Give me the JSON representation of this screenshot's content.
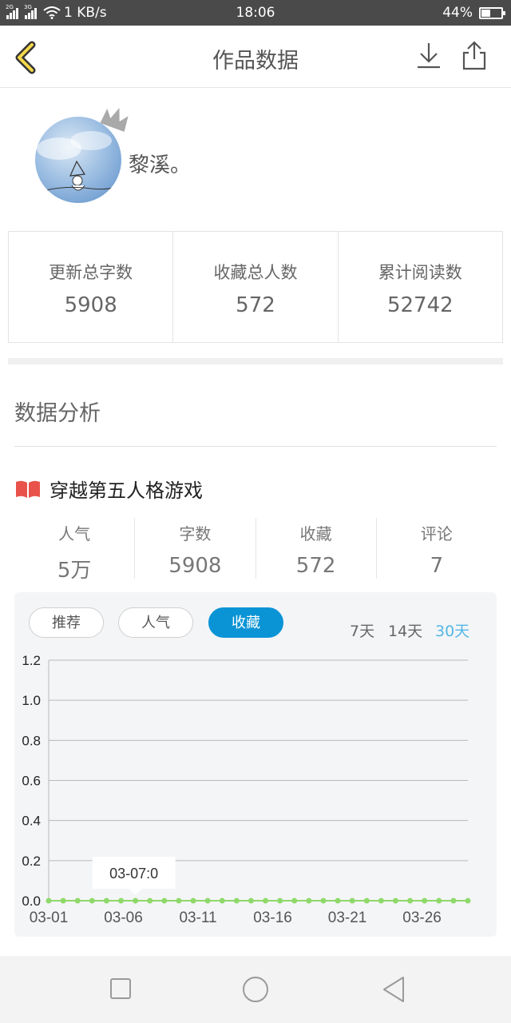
{
  "status_bar": {
    "signal_1_label": "2G",
    "signal_2_label": "3G",
    "network_speed": "1 KB/s",
    "time": "18:06",
    "battery_percent": "44%",
    "battery_level": 0.44
  },
  "header": {
    "title": "作品数据",
    "back_icon": "chevron-left-icon",
    "download_icon": "download-icon",
    "share_icon": "share-icon"
  },
  "profile": {
    "username": "黎溪。"
  },
  "summary": [
    {
      "label": "更新总字数",
      "value": "5908"
    },
    {
      "label": "收藏总人数",
      "value": "572"
    },
    {
      "label": "累计阅读数",
      "value": "52742"
    }
  ],
  "analysis": {
    "section_title": "数据分析",
    "work_title": "穿越第五人格游戏",
    "book_icon": "open-book-icon",
    "metrics": [
      {
        "label": "人气",
        "value": "5万"
      },
      {
        "label": "字数",
        "value": "5908"
      },
      {
        "label": "收藏",
        "value": "572"
      },
      {
        "label": "评论",
        "value": "7"
      }
    ]
  },
  "chart_controls": {
    "tabs": [
      "推荐",
      "人气",
      "收藏"
    ],
    "active_tab": "收藏",
    "ranges": [
      "7天",
      "14天",
      "30天"
    ],
    "active_range": "30天",
    "accent_color": "#0a94d6",
    "range_active_color": "#53b7e6"
  },
  "chart_data": {
    "type": "line",
    "series": [
      {
        "values": [
          0,
          0,
          0,
          0,
          0,
          0,
          0,
          0,
          0,
          0,
          0,
          0,
          0,
          0,
          0,
          0,
          0,
          0,
          0,
          0,
          0,
          0,
          0,
          0,
          0,
          0,
          0,
          0,
          0,
          0
        ]
      }
    ],
    "x_tick_labels": [
      "03-01",
      "03-06",
      "03-11",
      "03-16",
      "03-21",
      "03-26"
    ],
    "y_tick_labels": [
      "0.0",
      "0.2",
      "0.4",
      "0.6",
      "0.8",
      "1.0",
      "1.2"
    ],
    "ylim": [
      0,
      1.2
    ],
    "grid": true,
    "point_color": "#8fd96a",
    "tooltip": {
      "text": "03-07:0",
      "index": 6
    }
  },
  "nav_bar": {
    "icons": [
      "square-icon",
      "circle-icon",
      "triangle-back-icon"
    ]
  }
}
